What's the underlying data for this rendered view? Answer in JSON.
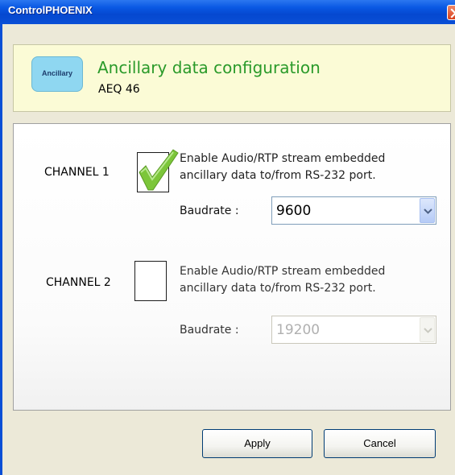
{
  "window": {
    "title": "ControlPHOENIX",
    "close_icon": "close-icon"
  },
  "header": {
    "logo_text": "Ancillary",
    "title": "Ancillary data configuration",
    "subtitle": "AEQ 46",
    "title_color": "#2a9a2a"
  },
  "channels": [
    {
      "label": "CHANNEL 1",
      "checked": true,
      "description_line1": "Enable Audio/RTP stream embedded",
      "description_line2": "ancillary data to/from RS-232 port.",
      "baud_label": "Baudrate :",
      "baud_value": "9600",
      "enabled": true
    },
    {
      "label": "CHANNEL 2",
      "checked": false,
      "description_line1": "Enable Audio/RTP stream embedded",
      "description_line2": "ancillary data to/from RS-232 port.",
      "baud_label": "Baudrate :",
      "baud_value": "19200",
      "enabled": false
    }
  ],
  "buttons": {
    "apply": "Apply",
    "cancel": "Cancel"
  },
  "colors": {
    "titlebar": "#0a4fd6",
    "checkmark": "#7cc63a",
    "header_bg": "#fbfbd6"
  }
}
